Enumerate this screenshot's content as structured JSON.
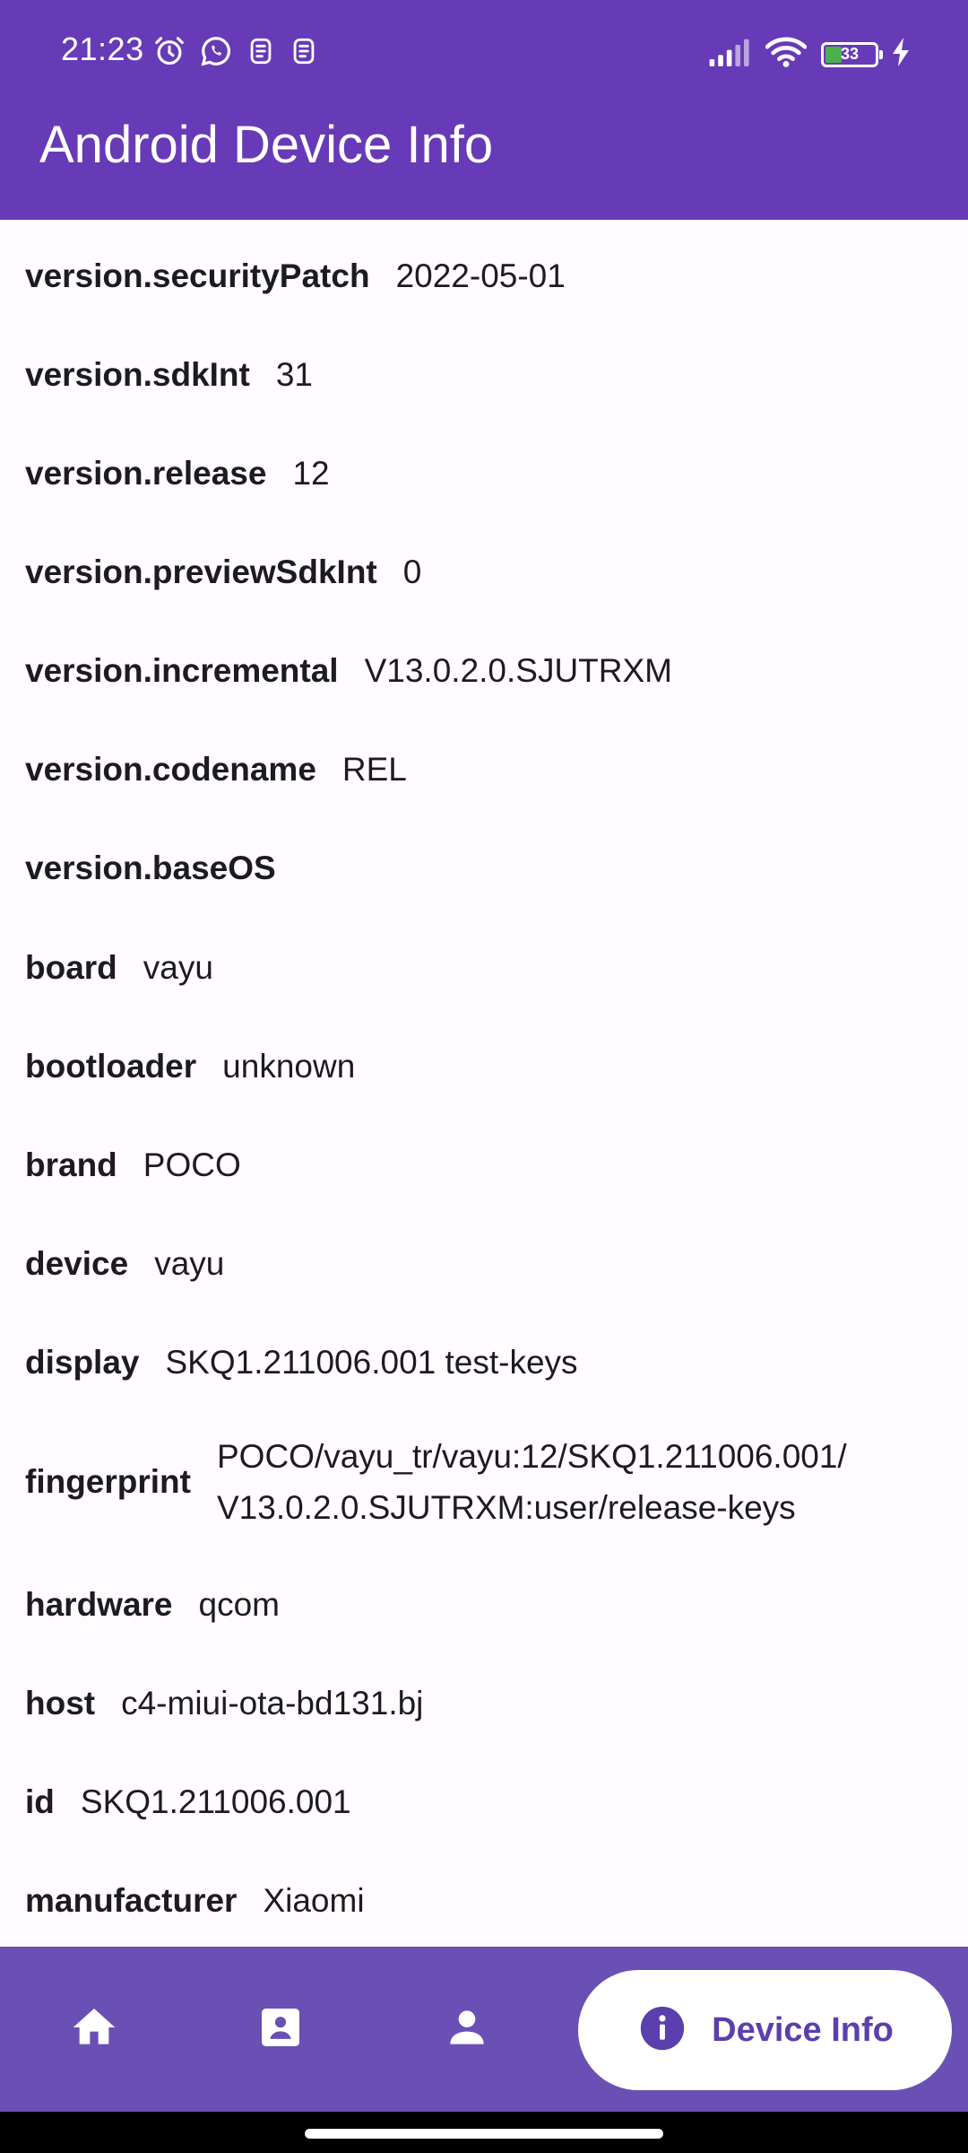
{
  "status_bar": {
    "time": "21:23",
    "battery_level": "33",
    "battery_fraction": 0.33,
    "icons_left": [
      "alarm-icon",
      "whatsapp-icon",
      "notification-icon",
      "notification-icon"
    ],
    "icons_right": [
      "signal-icon",
      "wifi-icon",
      "battery-icon",
      "charging-icon"
    ]
  },
  "app_bar": {
    "title": "Android Device Info",
    "background_color": "#673ab7"
  },
  "rows": [
    {
      "key": "version.securityPatch",
      "value": "2022-05-01"
    },
    {
      "key": "version.sdkInt",
      "value": "31"
    },
    {
      "key": "version.release",
      "value": "12"
    },
    {
      "key": "version.previewSdkInt",
      "value": "0"
    },
    {
      "key": "version.incremental",
      "value": "V13.0.2.0.SJUTRXM"
    },
    {
      "key": "version.codename",
      "value": "REL"
    },
    {
      "key": "version.baseOS",
      "value": ""
    },
    {
      "key": "board",
      "value": "vayu"
    },
    {
      "key": "bootloader",
      "value": "unknown"
    },
    {
      "key": "brand",
      "value": "POCO"
    },
    {
      "key": "device",
      "value": "vayu"
    },
    {
      "key": "display",
      "value": "SKQ1.211006.001 test-keys"
    },
    {
      "key": "fingerprint",
      "value_line1": "POCO/vayu_tr/vayu:12/SKQ1.211006.001/",
      "value_line2": "V13.0.2.0.SJUTRXM:user/release-keys"
    },
    {
      "key": "hardware",
      "value": "qcom"
    },
    {
      "key": "host",
      "value": "c4-miui-ota-bd131.bj"
    },
    {
      "key": "id",
      "value": "SKQ1.211006.001"
    },
    {
      "key": "manufacturer",
      "value": "Xiaomi"
    }
  ],
  "bottom_nav": {
    "items": [
      {
        "icon": "home-icon"
      },
      {
        "icon": "document-icon"
      },
      {
        "icon": "person-icon"
      }
    ],
    "active": {
      "icon": "info-icon",
      "label": "Device Info"
    },
    "background_color": "#6a4fb5",
    "active_color": "#5b3fae"
  }
}
